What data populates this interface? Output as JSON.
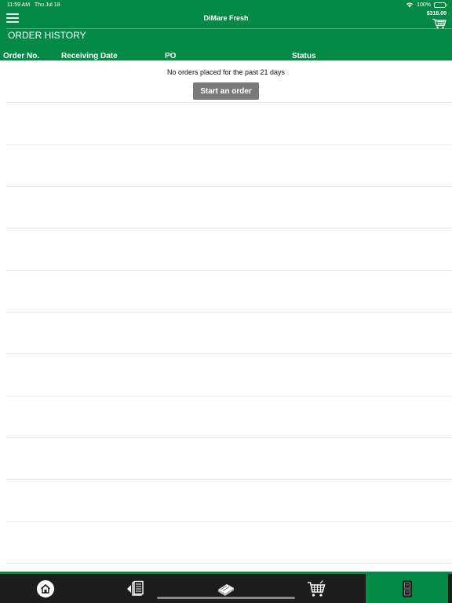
{
  "status_bar": {
    "time": "11:59 AM",
    "date": "Thu Jul 18",
    "battery": "100%"
  },
  "header": {
    "app_title": "DiMare Fresh",
    "cart_total": "$318.00",
    "page_title": "ORDER HISTORY",
    "columns": [
      "Order No.",
      "Receiving Date",
      "PO",
      "Status"
    ]
  },
  "main": {
    "empty_message": "No orders placed for the past 21 days",
    "start_button_label": "Start an order",
    "rows": [
      {
        "order_no": "",
        "receiving_date": "",
        "po": "",
        "status": ""
      },
      {
        "order_no": "",
        "receiving_date": "",
        "po": "",
        "status": ""
      },
      {
        "order_no": "",
        "receiving_date": "",
        "po": "",
        "status": ""
      },
      {
        "order_no": "",
        "receiving_date": "",
        "po": "",
        "status": ""
      },
      {
        "order_no": "",
        "receiving_date": "",
        "po": "",
        "status": ""
      },
      {
        "order_no": "",
        "receiving_date": "",
        "po": "",
        "status": ""
      },
      {
        "order_no": "",
        "receiving_date": "",
        "po": "",
        "status": ""
      },
      {
        "order_no": "",
        "receiving_date": "",
        "po": "",
        "status": ""
      },
      {
        "order_no": "",
        "receiving_date": "",
        "po": "",
        "status": ""
      },
      {
        "order_no": "",
        "receiving_date": "",
        "po": "",
        "status": ""
      },
      {
        "order_no": "",
        "receiving_date": "",
        "po": "",
        "status": ""
      },
      {
        "order_no": "",
        "receiving_date": "",
        "po": "",
        "status": ""
      }
    ]
  },
  "tab_bar": {
    "tabs": [
      {
        "icon": "home-icon",
        "active": false
      },
      {
        "icon": "order-guide-icon",
        "active": false
      },
      {
        "icon": "catalog-book-icon",
        "active": false
      },
      {
        "icon": "shopping-cart-icon",
        "active": false
      },
      {
        "icon": "order-history-icon",
        "active": true
      }
    ]
  },
  "colors": {
    "brand_green": "#058a45",
    "tab_bar_bg": "#1d1d1d",
    "button_gray": "#7a7a7a",
    "row_divider": "#e8e8e8"
  }
}
